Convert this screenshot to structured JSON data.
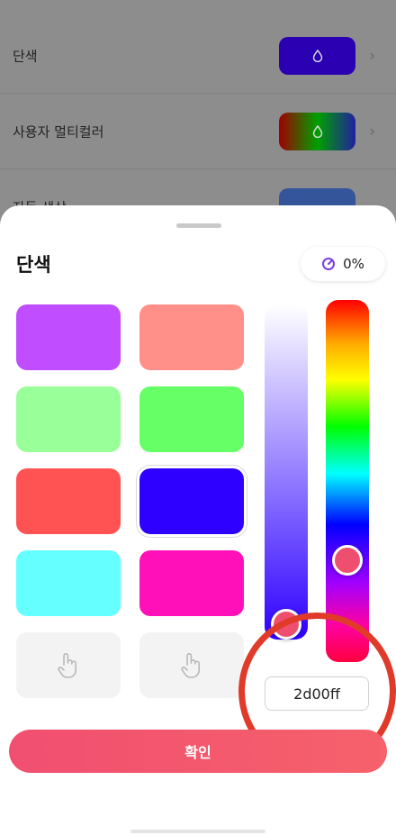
{
  "background_list": {
    "items": [
      {
        "label": "단색",
        "swatch": "#2d00ff"
      },
      {
        "label": "사용자 멀티컬러",
        "swatch": "gradient"
      },
      {
        "label": "자동 색상 ›",
        "swatch": "#3b6fd6"
      }
    ]
  },
  "sheet": {
    "title": "단색",
    "percent": "0%",
    "swatches": [
      {
        "color": "#c04dff"
      },
      {
        "color": "#ff8f88"
      },
      {
        "color": "#99ff99"
      },
      {
        "color": "#66ff66"
      },
      {
        "color": "#ff5252"
      },
      {
        "color": "#2d00ff",
        "selected": true
      },
      {
        "color": "#66ffff"
      },
      {
        "color": "#ff10b8"
      },
      {
        "color": null
      },
      {
        "color": null
      }
    ],
    "saturation_level": 1.0,
    "hue_level": 0.72,
    "hex_value": "2d00ff",
    "confirm_label": "확인"
  },
  "colors": {
    "accent": "#f14f70",
    "highlight_ring": "#e03a2a"
  }
}
